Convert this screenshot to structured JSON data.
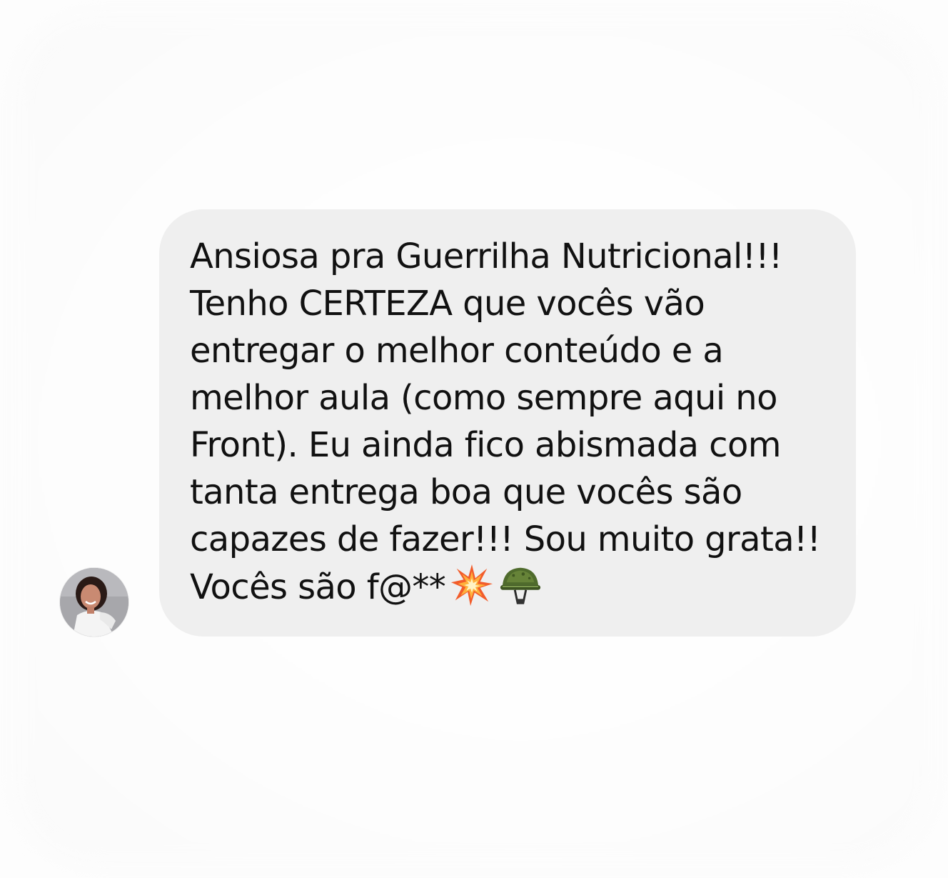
{
  "message": {
    "lines": [
      "Ansiosa pra Guerrilha Nutricional!!!",
      "Tenho CERTEZA que vocês vão",
      "entregar o melhor conteúdo e a",
      "melhor aula (como sempre aqui no",
      "Front). Eu ainda fico abismada com",
      "tanta entrega boa que vocês são",
      "capazes de fazer!!! Sou muito grata!!",
      "Vocês são f@**"
    ],
    "emojis": [
      "collision-icon",
      "military-helmet-icon"
    ],
    "bubble_color": "#efefef",
    "text_color": "#111111"
  },
  "sender": {
    "avatar": "user-avatar"
  }
}
